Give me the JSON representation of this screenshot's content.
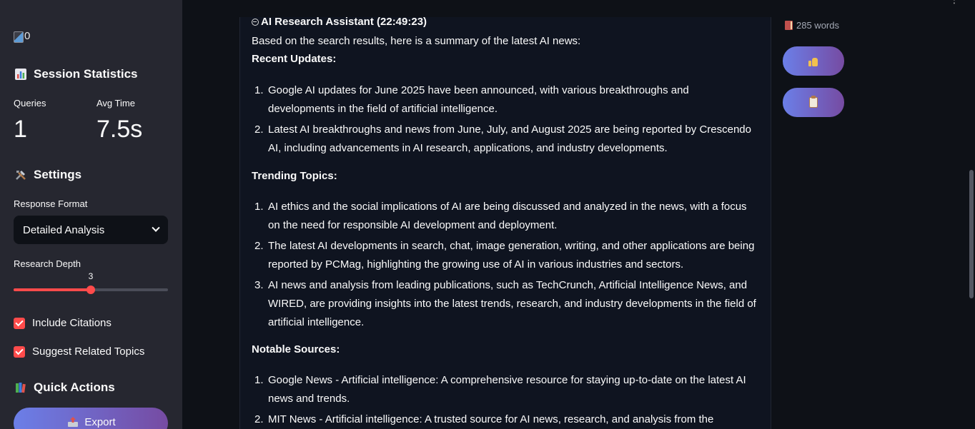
{
  "sidebar": {
    "logo_alt": "0",
    "session_stats": {
      "heading": "Session Statistics",
      "queries_label": "Queries",
      "queries_value": "1",
      "avg_time_label": "Avg Time",
      "avg_time_value": "7.5s"
    },
    "settings": {
      "heading": "Settings",
      "response_format_label": "Response Format",
      "response_format_value": "Detailed Analysis",
      "research_depth_label": "Research Depth",
      "research_depth_value": "3",
      "research_depth_fraction": 0.5,
      "include_citations_label": "Include Citations",
      "include_citations_checked": true,
      "suggest_topics_label": "Suggest Related Topics",
      "suggest_topics_checked": true
    },
    "quick_actions": {
      "heading": "Quick Actions",
      "export_label": "Export"
    }
  },
  "chat": {
    "assistant_header": "AI Research Assistant (22:49:23)",
    "intro": "Based on the search results, here is a summary of the latest AI news:",
    "recent_heading": "Recent Updates:",
    "recent_items": [
      "Google AI updates for June 2025 have been announced, with various breakthroughs and developments in the field of artificial intelligence.",
      "Latest AI breakthroughs and news from June, July, and August 2025 are being reported by Crescendo AI, including advancements in AI research, applications, and industry developments."
    ],
    "trending_heading": "Trending Topics:",
    "trending_items": [
      "AI ethics and the social implications of AI are being discussed and analyzed in the news, with a focus on the need for responsible AI development and deployment.",
      "The latest AI developments in search, chat, image generation, writing, and other applications are being reported by PCMag, highlighting the growing use of AI in various industries and sectors.",
      "AI news and analysis from leading publications, such as TechCrunch, Artificial Intelligence News, and WIRED, are providing insights into the latest trends, research, and industry developments in the field of artificial intelligence."
    ],
    "sources_heading": "Notable Sources:",
    "sources_items": [
      "Google News - Artificial intelligence: A comprehensive resource for staying up-to-date on the latest AI news and trends.",
      "MIT News - Artificial intelligence: A trusted source for AI news, research, and analysis from the"
    ]
  },
  "actions": {
    "word_count": "285 words"
  },
  "colors": {
    "accent": "#ff4b4b",
    "button_gradient_start": "#6b7fe8",
    "button_gradient_end": "#764ba2",
    "sidebar_bg": "#262730",
    "main_bg": "#0e1117"
  },
  "icons": {
    "stats": "bar-chart-icon",
    "settings": "hammer-wrench-icon",
    "quick_actions": "books-icon",
    "export": "outbox-tray-icon",
    "assistant": "robot-face-icon",
    "word_count": "book-icon",
    "like": "thumbs-up-icon",
    "copy": "clipboard-icon"
  }
}
